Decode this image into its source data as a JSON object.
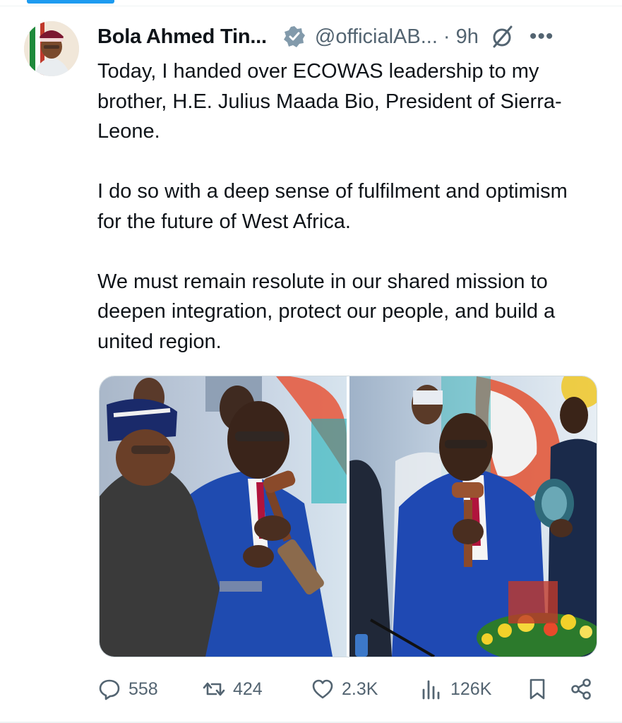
{
  "tweet": {
    "author_name": "Bola Ahmed Tin...",
    "handle": "@officialAB...",
    "separator": "·",
    "time": "9h",
    "more_label": "•••",
    "verified": true,
    "paragraphs": [
      "Today, I handed over ECOWAS leadership to my brother, H.E. Julius Maada Bio, President of Sierra-Leone.",
      "I do so with a deep sense of fulfilment and optimism for the future of West Africa.",
      "We must remain resolute in our shared mission to deepen integration, protect our people, and build a united region."
    ],
    "media": [
      {
        "description_icon": "photo-handover-gavel"
      },
      {
        "description_icon": "photo-bio-with-gavel"
      }
    ]
  },
  "actions": {
    "replies": "558",
    "reposts": "424",
    "likes": "2.3K",
    "views": "126K"
  },
  "colors": {
    "accent": "#1d9bf0",
    "text": "#0f1419",
    "muted": "#536471",
    "border": "#cfd9de",
    "badge_gray": "#829aab"
  }
}
